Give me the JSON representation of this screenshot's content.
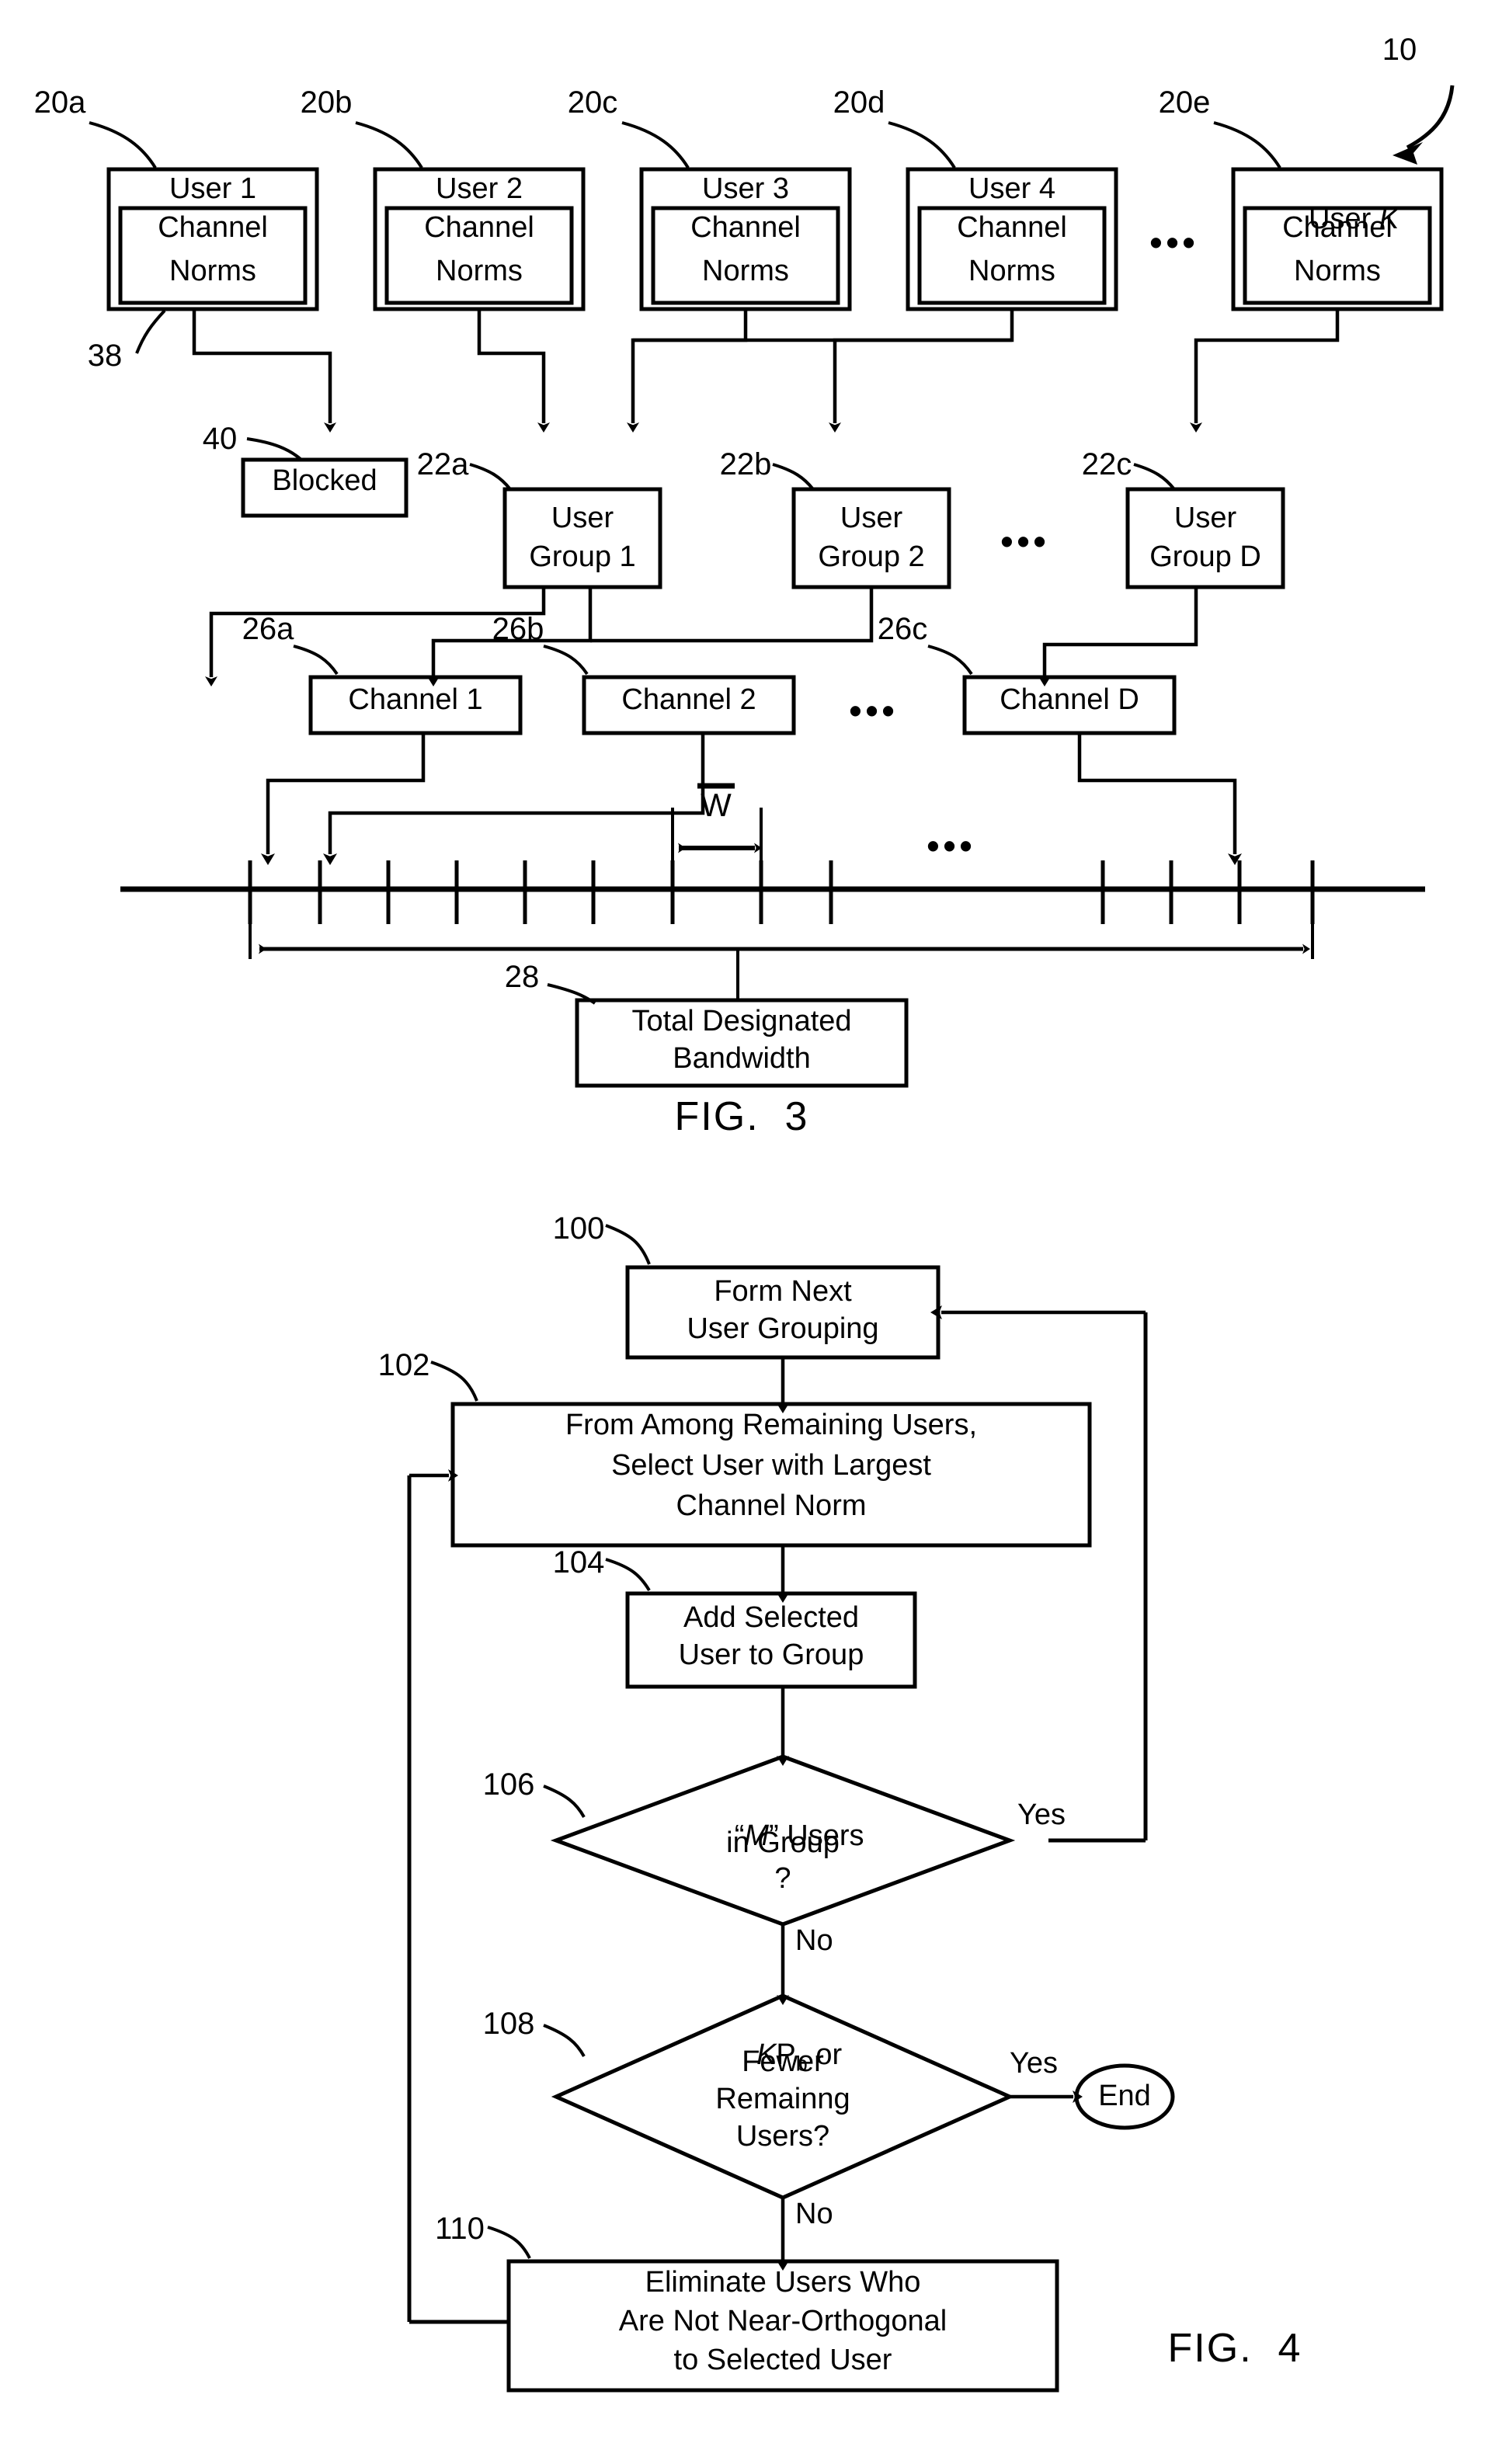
{
  "figure3": {
    "ref_main": "10",
    "users": [
      {
        "ref": "20a",
        "title": "User 1",
        "sub_line1": "Channel",
        "sub_line2": "Norms"
      },
      {
        "ref": "20b",
        "title": "User 2",
        "sub_line1": "Channel",
        "sub_line2": "Norms"
      },
      {
        "ref": "20c",
        "title": "User 3",
        "sub_line1": "Channel",
        "sub_line2": "Norms"
      },
      {
        "ref": "20d",
        "title": "User 4",
        "sub_line1": "Channel",
        "sub_line2": "Norms"
      },
      {
        "ref": "20e",
        "title": "User K",
        "title_italic_part": "K",
        "sub_line1": "Channel",
        "sub_line2": "Norms"
      }
    ],
    "users_ellipsis": "•••",
    "ref_38": "38",
    "ref_40": "40",
    "blocked_label": "Blocked",
    "groups": [
      {
        "ref": "22a",
        "line1": "User",
        "line2": "Group 1"
      },
      {
        "ref": "22b",
        "line1": "User",
        "line2": "Group 2"
      },
      {
        "ref": "22c",
        "line1": "User",
        "line2": "Group D"
      }
    ],
    "groups_ellipsis": "•••",
    "channels": [
      {
        "ref": "26a",
        "label": "Channel 1"
      },
      {
        "ref": "26b",
        "label": "Channel 2"
      },
      {
        "ref": "26c",
        "label": "Channel D"
      }
    ],
    "channels_ellipsis": "•••",
    "axis_ellipsis": "•••",
    "w_label": "W",
    "ref_28": "28",
    "bandwidth_line1": "Total Designated",
    "bandwidth_line2": "Bandwidth",
    "fig_label": "FIG.  3"
  },
  "figure4": {
    "step_100": {
      "ref": "100",
      "line1": "Form Next",
      "line2": "User Grouping"
    },
    "step_102": {
      "ref": "102",
      "line1": "From Among Remaining Users,",
      "line2": "Select User with Largest",
      "line3": "Channel Norm"
    },
    "step_104": {
      "ref": "104",
      "line1": "Add Selected",
      "line2": "User to Group"
    },
    "decision_106": {
      "ref": "106",
      "line1": "“M” Users",
      "italic_sym": "M",
      "line2": "in Group",
      "line3": "?",
      "yes_label": "Yes",
      "no_label": "No"
    },
    "decision_108": {
      "ref": "108",
      "line1": "KPb or",
      "line2": "Fewer",
      "line3": "Remainng",
      "line4": "Users?",
      "yes_label": "Yes",
      "no_label": "No",
      "sym_k": "K",
      "sym_p": "P",
      "sym_b": "b"
    },
    "end_node": "End",
    "step_110": {
      "ref": "110",
      "line1": "Eliminate Users Who",
      "line2": "Are Not Near-Orthogonal",
      "line3": "to Selected User"
    },
    "fig_label": "FIG.  4"
  },
  "colors": {
    "ink": "#000000",
    "paper": "#ffffff"
  }
}
